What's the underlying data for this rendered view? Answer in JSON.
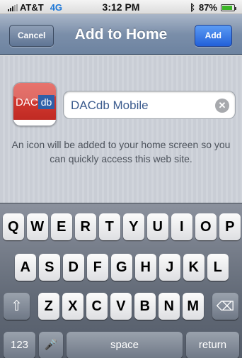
{
  "status_bar": {
    "carrier": "AT&T",
    "network": "4G",
    "time": "3:12 PM",
    "battery_text": "87%",
    "battery_level": 0.87,
    "bluetooth_icon": "bluetooth-icon",
    "network_color": "#1d78d8"
  },
  "nav": {
    "title": "Add to Home",
    "cancel_label": "Cancel",
    "add_label": "Add"
  },
  "form": {
    "icon_text_left": "DAC",
    "icon_text_right": "db",
    "name_value": "DACdb Mobile",
    "clear_icon": "clear-icon",
    "hint": "An icon will be added to your home screen so you can quickly access this web site."
  },
  "keyboard": {
    "row1": [
      "Q",
      "W",
      "E",
      "R",
      "T",
      "Y",
      "U",
      "I",
      "O",
      "P"
    ],
    "row2": [
      "A",
      "S",
      "D",
      "F",
      "G",
      "H",
      "J",
      "K",
      "L"
    ],
    "row3": [
      "Z",
      "X",
      "C",
      "V",
      "B",
      "N",
      "M"
    ],
    "shift_icon": "shift-icon",
    "delete_icon": "delete-icon",
    "numbers_label": "123",
    "mic_icon": "microphone-icon",
    "space_label": "space",
    "return_label": "return"
  }
}
